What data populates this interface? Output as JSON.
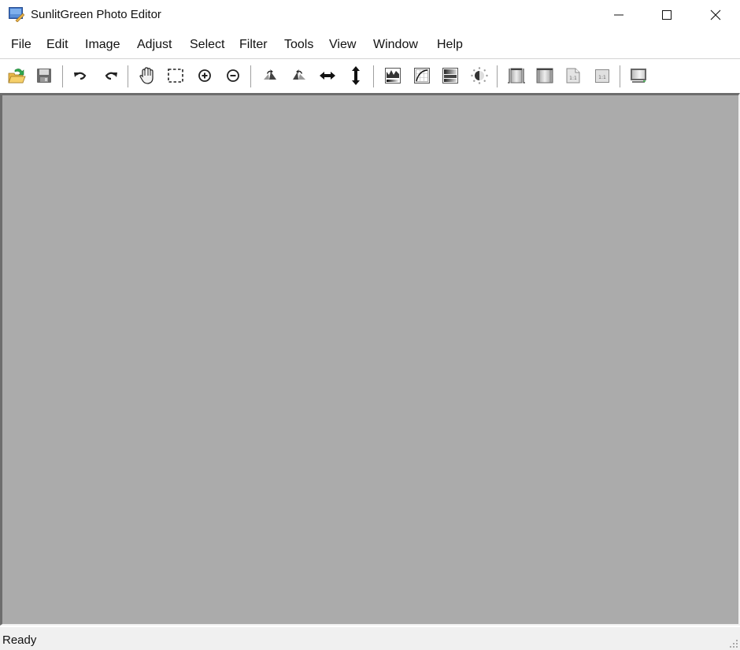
{
  "window": {
    "title": "SunlitGreen Photo Editor",
    "controls": [
      "minimize",
      "maximize",
      "close"
    ]
  },
  "menu": {
    "items": [
      "File",
      "Edit",
      "Image",
      "Adjust",
      "Select",
      "Filter",
      "Tools",
      "View",
      "Window",
      "Help"
    ]
  },
  "toolbar": {
    "groups": [
      [
        "open-icon",
        "save-icon"
      ],
      [
        "undo-icon",
        "redo-icon"
      ],
      [
        "hand-pan-icon",
        "rectangle-select-icon",
        "zoom-in-icon",
        "zoom-out-icon"
      ],
      [
        "rotate-left-icon",
        "rotate-right-icon",
        "flip-horizontal-icon",
        "flip-vertical-icon"
      ],
      [
        "levels-icon",
        "curves-icon",
        "color-balance-icon",
        "brightness-contrast-icon"
      ],
      [
        "fit-width-icon",
        "fit-window-icon",
        "actual-size-page-icon",
        "actual-size-icon"
      ],
      [
        "fullscreen-icon"
      ]
    ]
  },
  "status": {
    "text": "Ready"
  }
}
